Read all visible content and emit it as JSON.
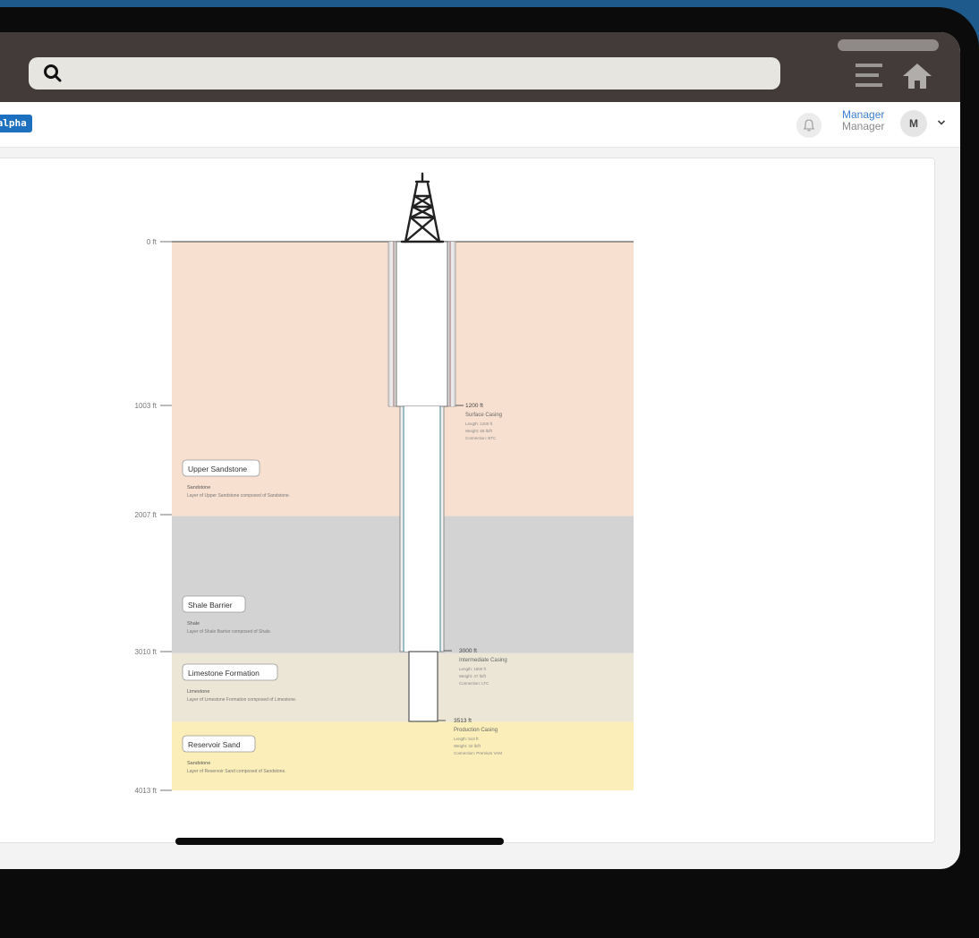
{
  "header": {
    "badge": "-alpha",
    "user_name": "Manager",
    "user_role": "Manager",
    "avatar_initial": "M"
  },
  "well": {
    "depth_ticks": [
      "0 ft",
      "1003 ft",
      "2007 ft",
      "3010 ft",
      "4013 ft"
    ],
    "layers": [
      {
        "name": "Upper Sandstone",
        "type": "Sandstone",
        "description": "Layer of Upper Sandstone composed of Sandstone.",
        "top_ft": 0,
        "bottom_ft": 2007,
        "color": "#f8e0d0"
      },
      {
        "name": "Shale Barrier",
        "type": "Shale",
        "description": "Layer of Shale Barrier composed of Shale.",
        "top_ft": 2007,
        "bottom_ft": 3010,
        "color": "#d3d3d3"
      },
      {
        "name": "Limestone Formation",
        "type": "Limestone",
        "description": "Layer of Limestone Formation composed of Limestone.",
        "top_ft": 3010,
        "bottom_ft": 3513,
        "color": "#ebe6d5"
      },
      {
        "name": "Reservoir Sand",
        "type": "Sandstone",
        "description": "Layer of Reservoir Sand composed of Sandstone.",
        "top_ft": 3513,
        "bottom_ft": 4013,
        "color": "#fbeeb8"
      }
    ],
    "casings": [
      {
        "depth_label": "1200 ft",
        "name": "Surface Casing",
        "length": "Length: 1200 ft",
        "weight": "Weight: 68 lb/ft",
        "connection": "Connection: BTC"
      },
      {
        "depth_label": "3000 ft",
        "name": "Intermediate Casing",
        "length": "Length: 1800 ft",
        "weight": "Weight: 47 lb/ft",
        "connection": "Connection: LTC"
      },
      {
        "depth_label": "3513 ft",
        "name": "Production Casing",
        "length": "Length: 513 ft",
        "weight": "Weight: 32 lb/ft",
        "connection": "Connection: Premium VAM"
      }
    ]
  }
}
